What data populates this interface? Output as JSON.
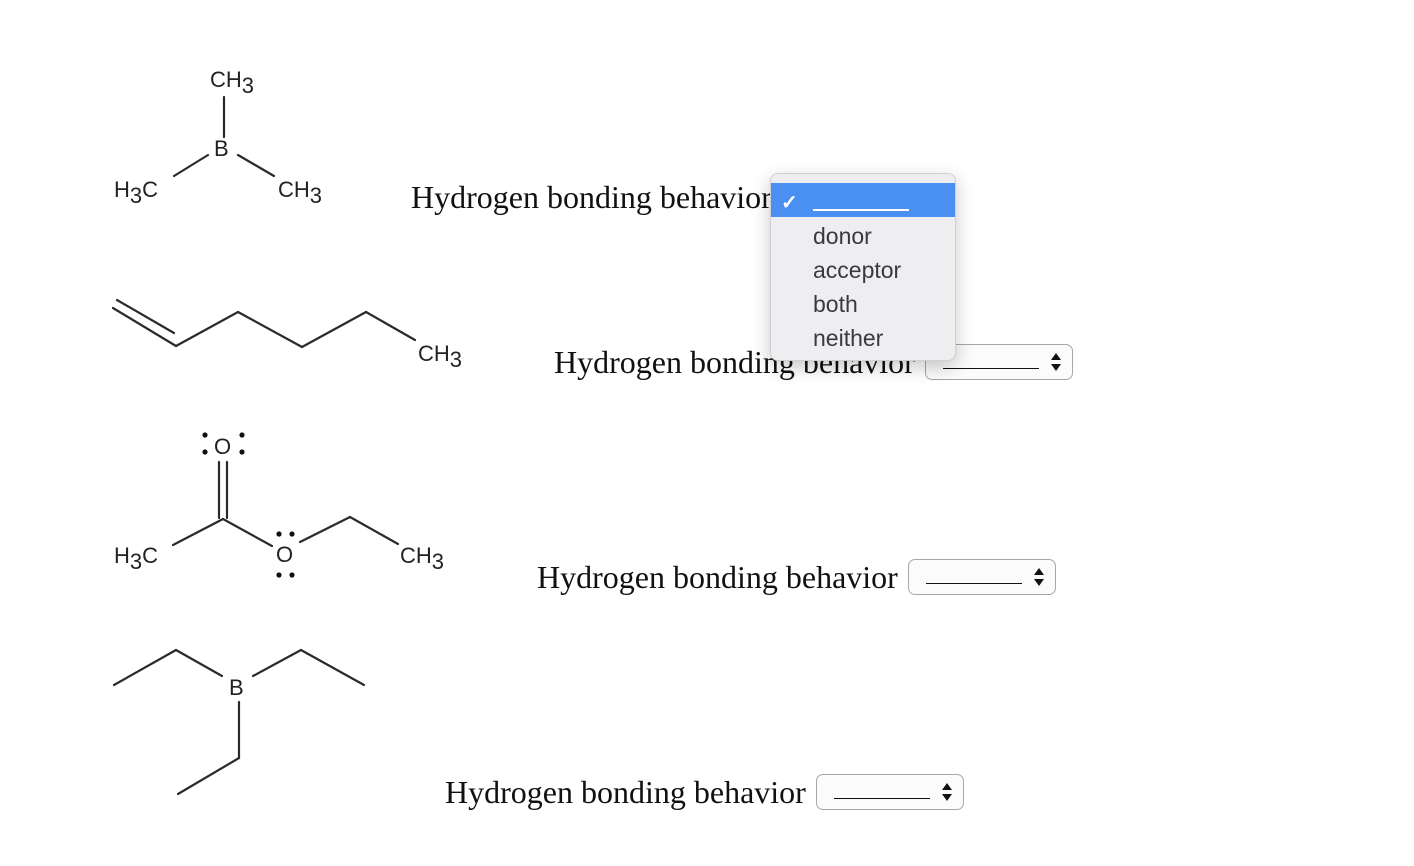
{
  "molecules": [
    {
      "name": "trimethylborane",
      "labels": {
        "top": "CH",
        "top_sub": "3",
        "center": "B",
        "left": "H",
        "left_sub": "3",
        "left_tail": "C",
        "right": "CH",
        "right_sub": "3"
      }
    },
    {
      "name": "1-hexene",
      "labels": {
        "end": "CH",
        "end_sub": "3"
      }
    },
    {
      "name": "ethyl-acetate",
      "labels": {
        "carbonyl_o": "O",
        "ester_o": "O",
        "left": "H",
        "left_sub": "3",
        "left_tail": "C",
        "right": "CH",
        "right_sub": "3"
      }
    },
    {
      "name": "triethylborane",
      "labels": {
        "center": "B"
      }
    }
  ],
  "questions": [
    {
      "label": "Hydrogen bonding behavior",
      "selected": "______"
    },
    {
      "label": "Hydrogen bonding behavior",
      "selected": "______"
    },
    {
      "label": "Hydrogen bonding behavior",
      "selected": "______"
    },
    {
      "label": "Hydrogen bonding behavior",
      "selected": "______"
    }
  ],
  "dropdown": {
    "open_for_question": 1,
    "options": [
      {
        "label": "______",
        "selected": true
      },
      {
        "label": "donor",
        "selected": false
      },
      {
        "label": "acceptor",
        "selected": false
      },
      {
        "label": "both",
        "selected": false
      },
      {
        "label": "neither",
        "selected": false
      }
    ],
    "highlight_color": "#4a90f3",
    "check_icon": "✓"
  }
}
